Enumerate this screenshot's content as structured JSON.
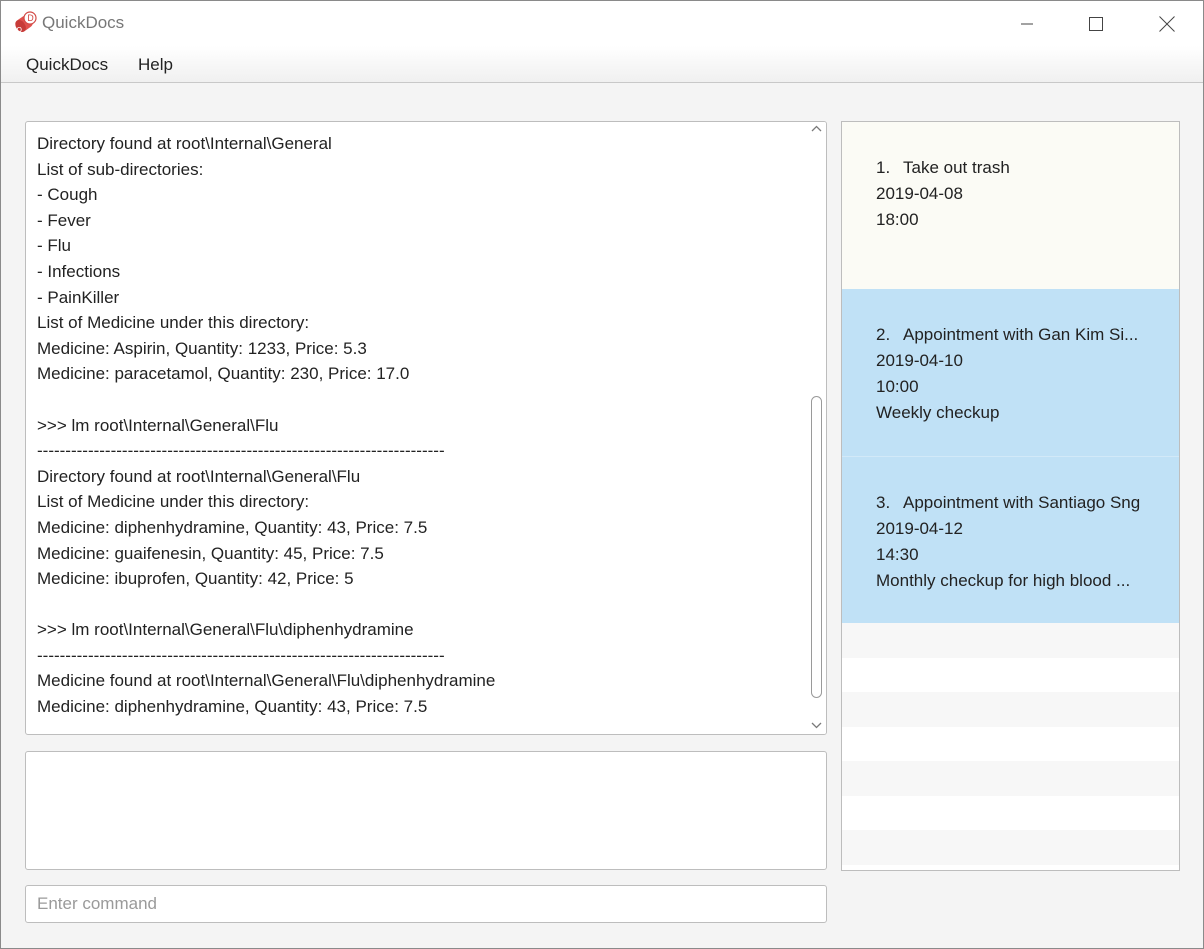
{
  "window": {
    "title": "QuickDocs",
    "accent_color": "#c0e1f6",
    "icon": "pill-bottle-icon"
  },
  "menu": {
    "items": [
      {
        "label": "QuickDocs"
      },
      {
        "label": "Help"
      }
    ]
  },
  "output": {
    "lines": [
      "Directory found at root\\Internal\\General",
      "List of sub-directories:",
      "- Cough",
      "- Fever",
      "- Flu",
      "- Infections",
      "- PainKiller",
      "List of Medicine under this directory:",
      "Medicine: Aspirin, Quantity: 1233, Price: 5.3",
      "Medicine: paracetamol, Quantity: 230, Price: 17.0",
      "",
      ">>> lm root\\Internal\\General\\Flu",
      "------------------------------------------------------------------------",
      "Directory found at root\\Internal\\General\\Flu",
      "List of Medicine under this directory:",
      "Medicine: diphenhydramine, Quantity: 43, Price: 7.5",
      "Medicine: guaifenesin, Quantity: 45, Price: 7.5",
      "Medicine: ibuprofen, Quantity: 42, Price: 5",
      "",
      ">>> lm root\\Internal\\General\\Flu\\diphenhydramine",
      "------------------------------------------------------------------------",
      "Medicine found at root\\Internal\\General\\Flu\\diphenhydramine",
      "Medicine: diphenhydramine, Quantity: 43, Price: 7.5"
    ]
  },
  "command": {
    "placeholder": "Enter command",
    "value": ""
  },
  "reminders": [
    {
      "number": "1.",
      "title": "Take out trash",
      "date": "2019-04-08",
      "time": "18:00",
      "note": ""
    },
    {
      "number": "2.",
      "title": "Appointment with Gan Kim Si...",
      "date": "2019-04-10",
      "time": "10:00",
      "note": "Weekly checkup"
    },
    {
      "number": "3.",
      "title": "Appointment with Santiago Sng",
      "date": "2019-04-12",
      "time": "14:30",
      "note": "Monthly checkup for high blood ..."
    }
  ]
}
